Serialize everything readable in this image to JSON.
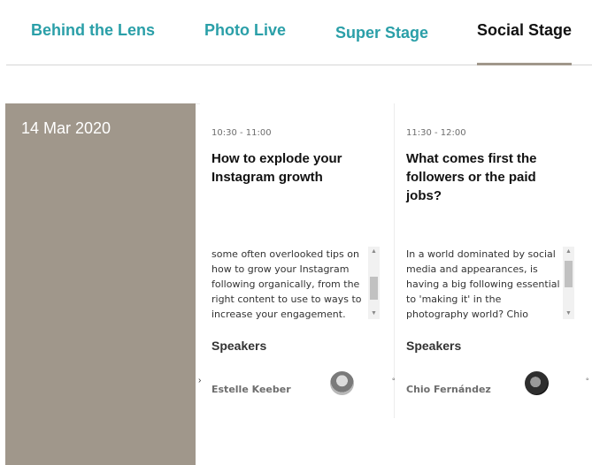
{
  "tabs": [
    {
      "label": "Behind the Lens",
      "active": false
    },
    {
      "label": "Photo Live",
      "active": false
    },
    {
      "label": "Super Stage",
      "active": false
    },
    {
      "label": "Social Stage",
      "active": true
    }
  ],
  "colors": {
    "accent": "#2a9fa8",
    "date_panel": "#a0978b"
  },
  "schedule": {
    "date": "14 Mar 2020",
    "sessions": [
      {
        "time": "10:30 - 11:00",
        "title": "How to explode your Instagram growth",
        "description": "some often overlooked tips on how to grow your Instagram following organically, from the right content to use to ways to increase your engagement.",
        "scroll_fraction": 0.55,
        "speakers_label": "Speakers",
        "speaker": "Estelle Keeber",
        "avatar_icon": "speaker-photo"
      },
      {
        "time": "11:30 - 12:00",
        "title": "What comes first the followers or the paid jobs?",
        "description": "In a world dominated by social media and appearances, is having a big following essential to 'making it' in the photography world? Chio Fernández discusses",
        "scroll_fraction": 0.3,
        "speakers_label": "Speakers",
        "speaker": "Chio Fernández",
        "avatar_icon": "speaker-photo"
      }
    ]
  }
}
